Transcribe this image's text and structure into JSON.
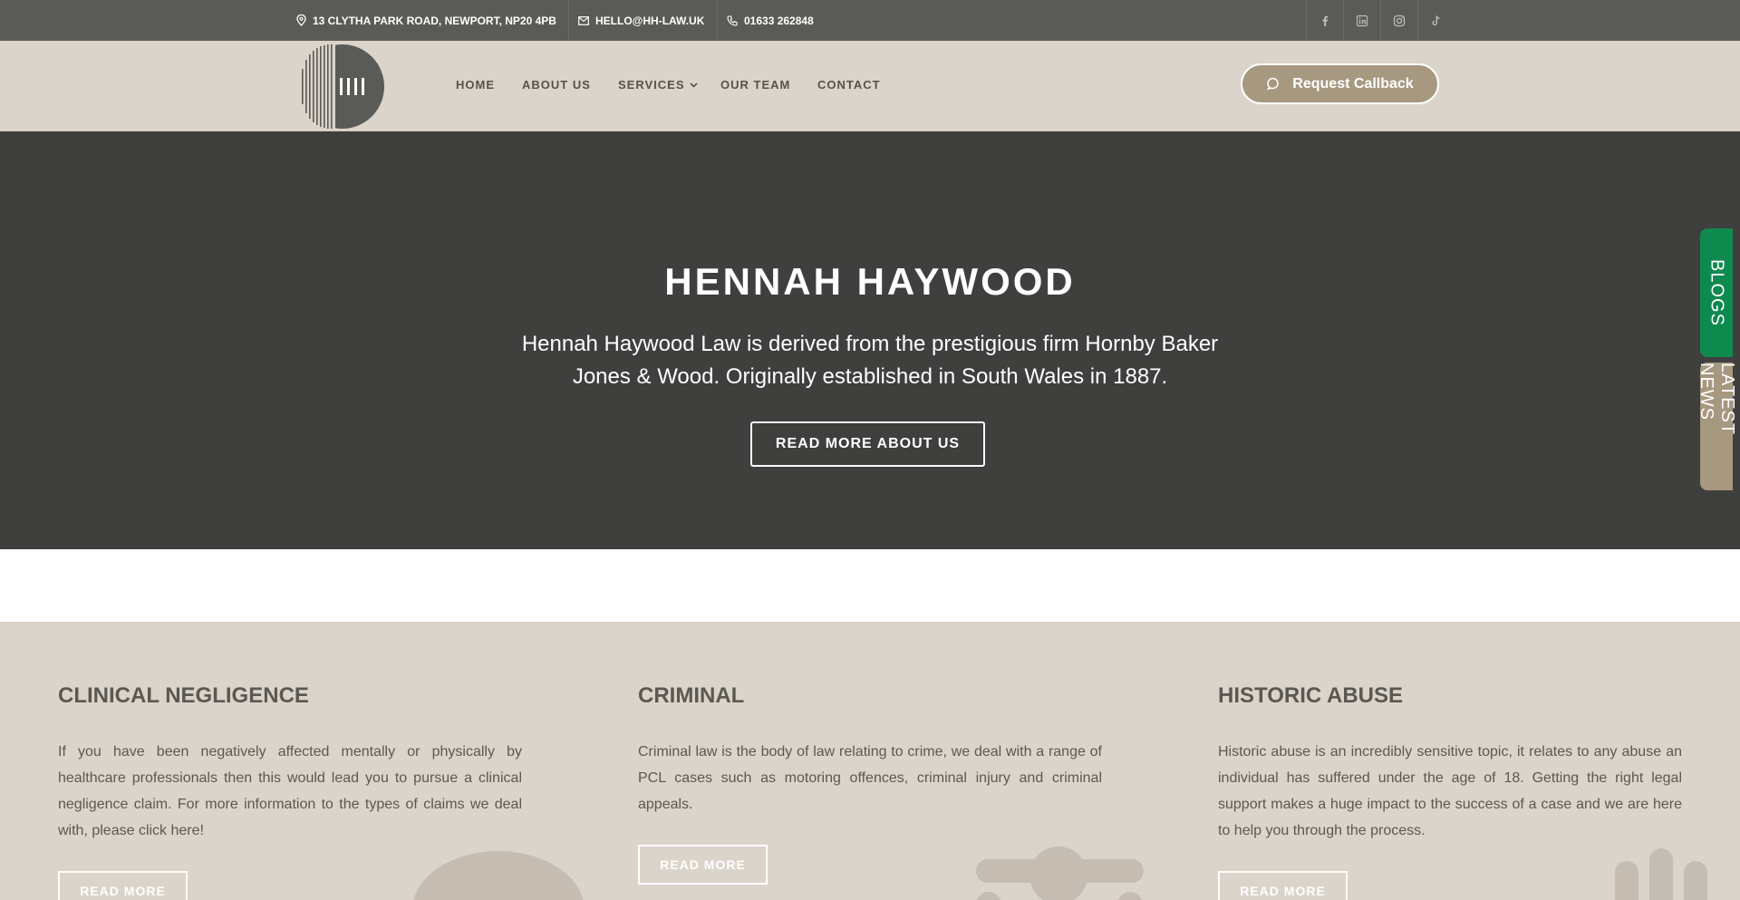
{
  "topbar": {
    "address": "13 CLYTHA PARK ROAD, NEWPORT, NP20 4PB",
    "email": "HELLO@HH-LAW.UK",
    "phone": "01633 262848",
    "social_icons": [
      "facebook-icon",
      "linkedin-icon",
      "instagram-icon",
      "tiktok-icon"
    ]
  },
  "header": {
    "nav": [
      {
        "label": "HOME"
      },
      {
        "label": "ABOUT US"
      },
      {
        "label": "SERVICES"
      },
      {
        "label": "OUR TEAM"
      },
      {
        "label": "CONTACT"
      }
    ],
    "callback_label": "Request Callback"
  },
  "hero": {
    "title": "HENNAH HAYWOOD",
    "text": "Hennah Haywood Law is derived from the prestigious firm Hornby Baker Jones & Wood. Originally established in South Wales in 1887.",
    "button_label": "READ MORE ABOUT US"
  },
  "side_tabs": {
    "blogs": "BLOGS",
    "latest_news": "LATEST NEWS"
  },
  "services": [
    {
      "title": "CLINICAL NEGLIGENCE",
      "text": "If you have been negatively affected mentally or physically by healthcare professionals then this would lead you to pursue a clinical negligence claim. For more information to the types of claims we deal with, please click here!",
      "button_label": "READ MORE"
    },
    {
      "title": "CRIMINAL",
      "text": "Criminal law is the body of law relating to crime, we deal with a range of PCL cases such as motoring offences, criminal injury and criminal appeals.",
      "button_label": "READ MORE"
    },
    {
      "title": "HISTORIC ABUSE",
      "text": "Historic abuse is an incredibly sensitive topic, it relates to any abuse an individual has suffered under the age of 18. Getting the right legal support makes a huge impact to the success of a case and we are here to help you through the process.",
      "button_label": "READ MORE"
    }
  ],
  "colors": {
    "topbar": "#5a5a56",
    "header": "#dbd4ca",
    "hero": "#3f3f3d",
    "accent": "#a79880",
    "blogs_tab": "#0f8a4f",
    "text": "#5b5852"
  }
}
